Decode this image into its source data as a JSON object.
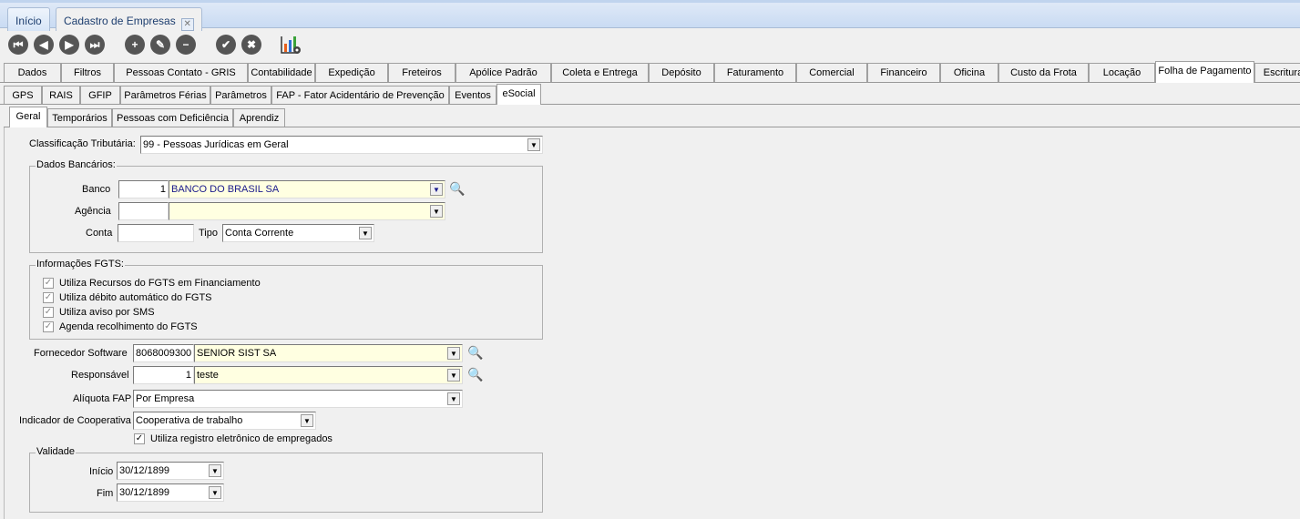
{
  "doc_tabs": [
    {
      "label": "Início"
    },
    {
      "label": "Cadastro de Empresas"
    }
  ],
  "toolbar": {
    "first": "⏮",
    "prev": "◀",
    "next": "▶",
    "last": "⏭",
    "add": "+",
    "edit": "✎",
    "remove": "−",
    "confirm": "✔",
    "cancel": "✖"
  },
  "main_tabs": [
    "Dados",
    "Filtros",
    "Pessoas Contato - GRIS",
    "Contabilidade",
    "Expedição",
    "Freteiros",
    "Apólice Padrão",
    "Coleta e Entrega",
    "Depósito",
    "Faturamento",
    "Comercial",
    "Financeiro",
    "Oficina",
    "Custo da Frota",
    "Locação",
    "Folha de Pagamento",
    "Escritura"
  ],
  "sub_tabs": [
    "GPS",
    "RAIS",
    "GFIP",
    "Parâmetros Férias",
    "Parâmetros",
    "FAP - Fator Acidentário de Prevenção",
    "Eventos",
    "eSocial"
  ],
  "esocial_tabs": [
    "Geral",
    "Temporários",
    "Pessoas com Deficiência",
    "Aprendiz"
  ],
  "form": {
    "classificacao_label": "Classificação Tributária:",
    "classificacao_value": "99 - Pessoas Jurídicas em Geral",
    "dados_bancarios": {
      "legend": "Dados Bancários:",
      "banco_label": "Banco",
      "banco_code": "1",
      "banco_name": "BANCO DO BRASIL SA",
      "agencia_label": "Agência",
      "agencia_code": "",
      "agencia_name": "",
      "conta_label": "Conta",
      "conta_value": "",
      "tipo_label": "Tipo",
      "tipo_value": "Conta Corrente"
    },
    "fgts": {
      "legend": "Informações FGTS:",
      "items": [
        {
          "label": "Utiliza Recursos do FGTS em Financiamento",
          "checked": true
        },
        {
          "label": "Utiliza débito automático do FGTS",
          "checked": true
        },
        {
          "label": "Utiliza aviso por SMS",
          "checked": true
        },
        {
          "label": "Agenda recolhimento do FGTS",
          "checked": true
        }
      ]
    },
    "fornecedor_label": "Fornecedor Software",
    "fornecedor_code": "8068009300",
    "fornecedor_name": "SENIOR SIST SA",
    "responsavel_label": "Responsável",
    "responsavel_code": "1",
    "responsavel_name": "teste",
    "aliquota_label": "Alíquota FAP",
    "aliquota_value": "Por Empresa",
    "cooperativa_label": "Indicador de Cooperativa",
    "cooperativa_value": "Cooperativa de trabalho",
    "registro_eletronico_label": "Utiliza registro eletrônico de empregados",
    "registro_eletronico_checked": true,
    "validade": {
      "legend": "Validade",
      "inicio_label": "Início",
      "inicio_value": "30/12/1899",
      "fim_label": "Fim",
      "fim_value": "30/12/1899"
    }
  }
}
